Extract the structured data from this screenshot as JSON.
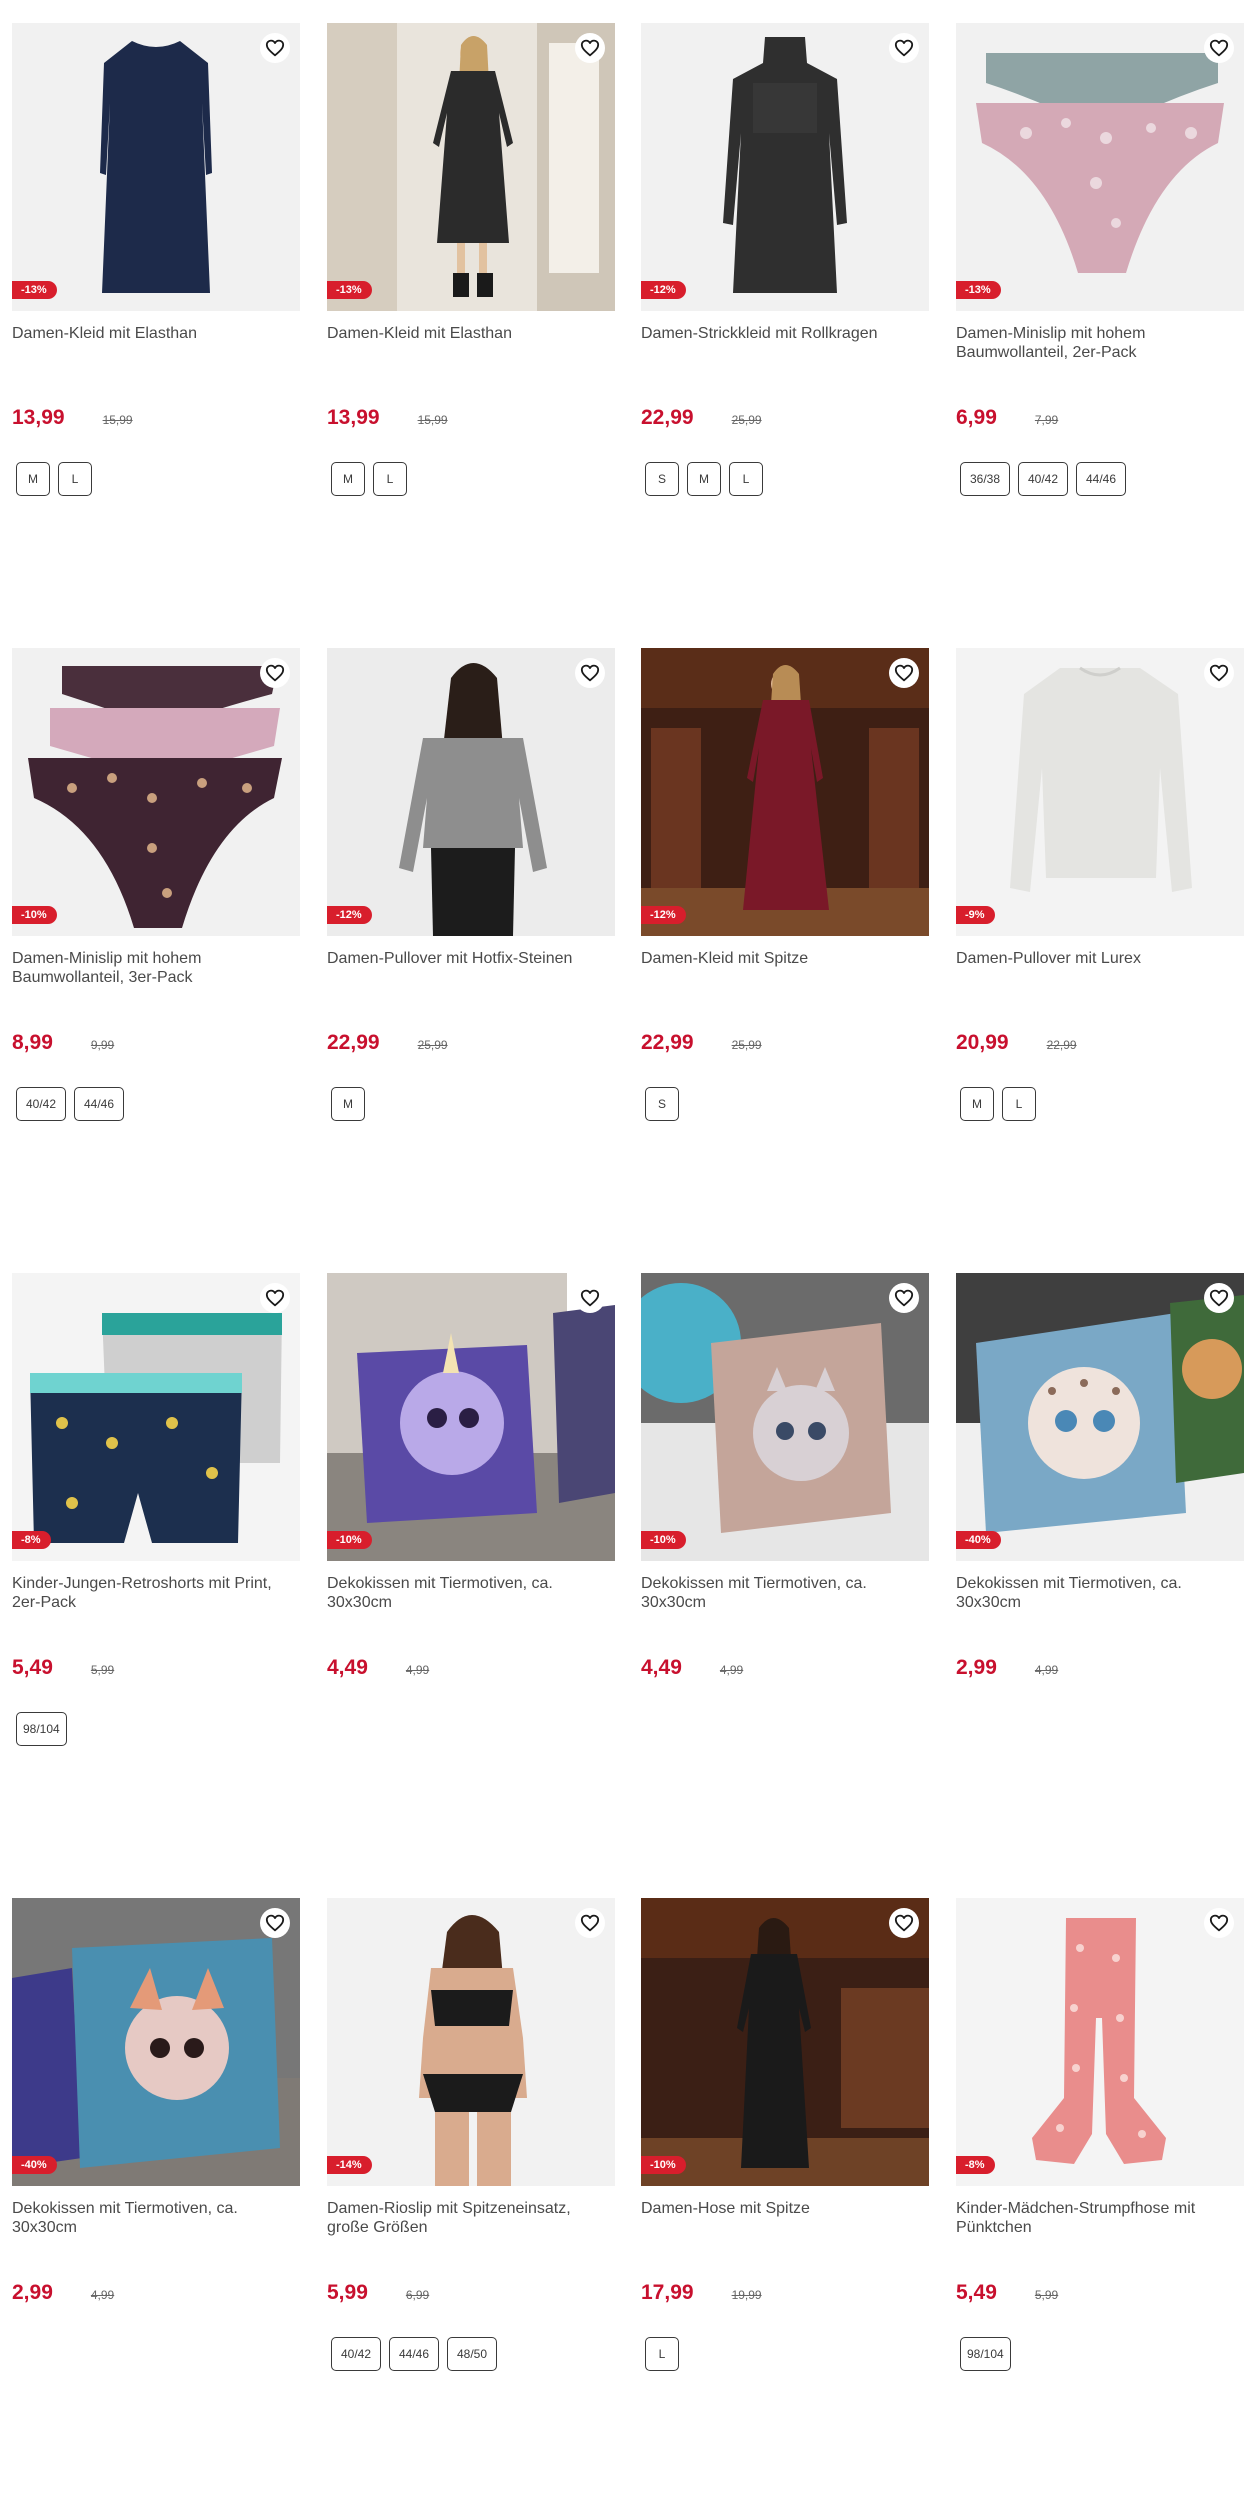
{
  "products": [
    {
      "title": "Damen-Kleid mit Elasthan",
      "discount": "-13%",
      "price": "13,99",
      "old_price": "15,99",
      "sizes": [
        "M",
        "L"
      ],
      "image": "navy-dress"
    },
    {
      "title": "Damen-Kleid mit Elasthan",
      "discount": "-13%",
      "price": "13,99",
      "old_price": "15,99",
      "sizes": [
        "M",
        "L"
      ],
      "image": "model-grey-dress"
    },
    {
      "title": "Damen-Strickkleid mit Rollkragen",
      "discount": "-12%",
      "price": "22,99",
      "old_price": "25,99",
      "sizes": [
        "S",
        "M",
        "L"
      ],
      "image": "knit-dress"
    },
    {
      "title": "Damen-Minislip mit hohem Baumwollanteil, 2er-Pack",
      "discount": "-13%",
      "price": "6,99",
      "old_price": "7,99",
      "sizes": [
        "36/38",
        "40/42",
        "44/46"
      ],
      "image": "briefs-2pack"
    },
    {
      "title": "Damen-Minislip mit hohem Baumwollanteil, 3er-Pack",
      "discount": "-10%",
      "price": "8,99",
      "old_price": "9,99",
      "sizes": [
        "40/42",
        "44/46"
      ],
      "image": "briefs-3pack"
    },
    {
      "title": "Damen-Pullover mit Hotfix-Steinen",
      "discount": "-12%",
      "price": "22,99",
      "old_price": "25,99",
      "sizes": [
        "M"
      ],
      "image": "model-grey-sweater"
    },
    {
      "title": "Damen-Kleid mit Spitze",
      "discount": "-12%",
      "price": "22,99",
      "old_price": "25,99",
      "sizes": [
        "S"
      ],
      "image": "model-burgundy-dress"
    },
    {
      "title": "Damen-Pullover mit Lurex",
      "discount": "-9%",
      "price": "20,99",
      "old_price": "22,99",
      "sizes": [
        "M",
        "L"
      ],
      "image": "white-sweater"
    },
    {
      "title": "Kinder-Jungen-Retroshorts mit Print, 2er-Pack",
      "discount": "-8%",
      "price": "5,49",
      "old_price": "5,99",
      "sizes": [
        "98/104"
      ],
      "image": "boys-shorts"
    },
    {
      "title": "Dekokissen mit Tiermotiven, ca. 30x30cm",
      "discount": "-10%",
      "price": "4,49",
      "old_price": "4,99",
      "sizes": [],
      "image": "pillow-unicorn"
    },
    {
      "title": "Dekokissen mit Tiermotiven, ca. 30x30cm",
      "discount": "-10%",
      "price": "4,49",
      "old_price": "4,99",
      "sizes": [],
      "image": "pillow-cat"
    },
    {
      "title": "Dekokissen mit Tiermotiven, ca. 30x30cm",
      "discount": "-40%",
      "price": "2,99",
      "old_price": "4,99",
      "sizes": [],
      "image": "pillow-leopard"
    },
    {
      "title": "Dekokissen mit Tiermotiven, ca. 30x30cm",
      "discount": "-40%",
      "price": "2,99",
      "old_price": "4,99",
      "sizes": [],
      "image": "pillow-fox"
    },
    {
      "title": "Damen-Rioslip mit Spitzeneinsatz, große Größen",
      "discount": "-14%",
      "price": "5,99",
      "old_price": "6,99",
      "sizes": [
        "40/42",
        "44/46",
        "48/50"
      ],
      "image": "model-lingerie"
    },
    {
      "title": "Damen-Hose mit Spitze",
      "discount": "-10%",
      "price": "17,99",
      "old_price": "19,99",
      "sizes": [
        "L"
      ],
      "image": "model-black-lace"
    },
    {
      "title": "Kinder-Mädchen-Strumpfhose mit Pünktchen",
      "discount": "-8%",
      "price": "5,49",
      "old_price": "5,99",
      "sizes": [
        "98/104"
      ],
      "image": "pink-tights"
    }
  ],
  "icons": {
    "wishlist": "heart-outline-icon"
  },
  "colors": {
    "price": "#c8102e",
    "badge": "#d81e2c"
  }
}
